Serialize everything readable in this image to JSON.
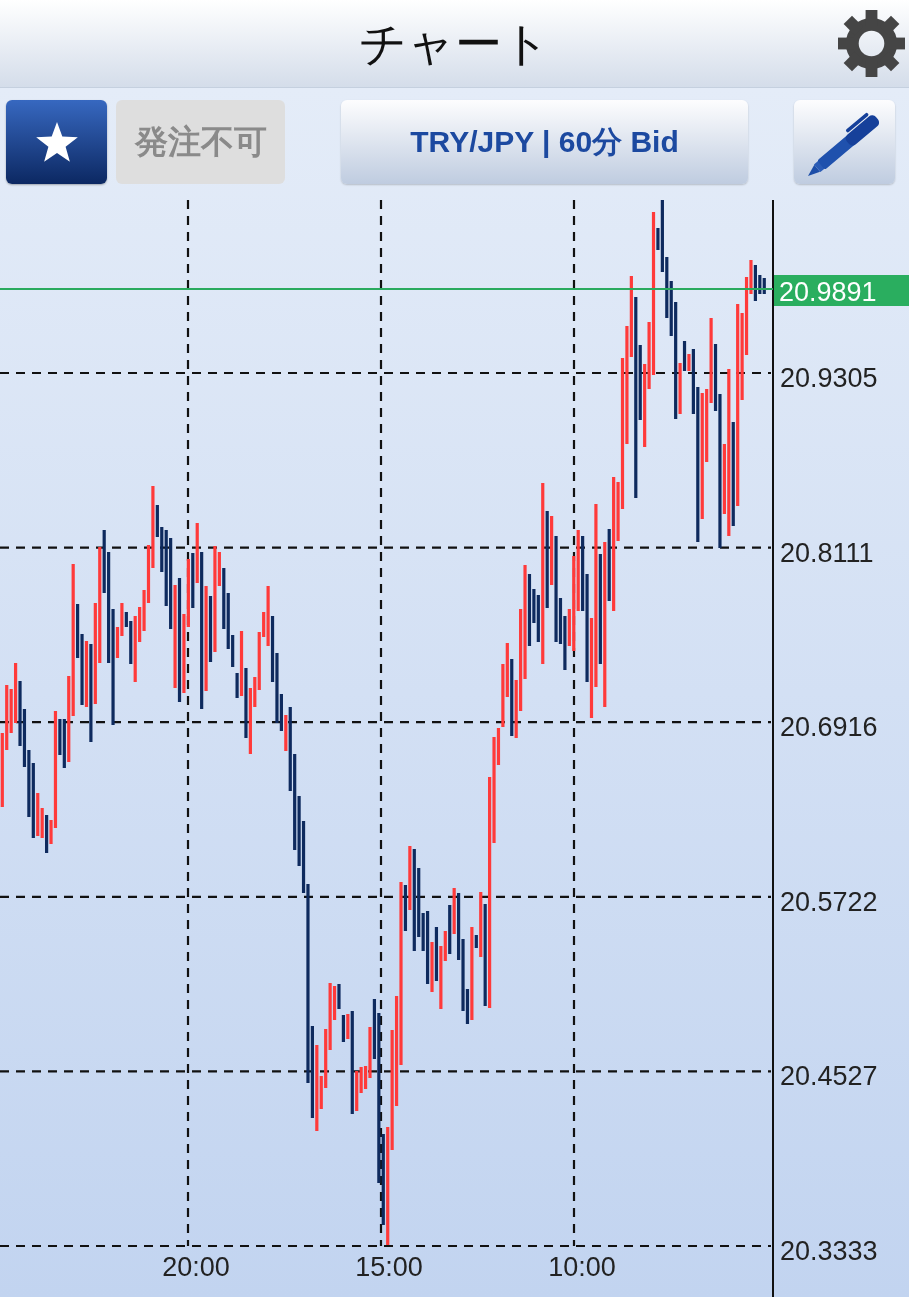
{
  "header": {
    "title": "チャート"
  },
  "toolbar": {
    "order_button": {
      "label": "発注不可",
      "disabled": true
    },
    "symbol_button": {
      "label": "TRY/JPY | 60分 Bid"
    }
  },
  "chart": {
    "current_price": "20.9891",
    "price_labels": [
      "20.9305",
      "20.8111",
      "20.6916",
      "20.5722",
      "20.4527",
      "20.3333"
    ],
    "time_labels": [
      "20:00",
      "15:00",
      "10:00"
    ]
  }
}
